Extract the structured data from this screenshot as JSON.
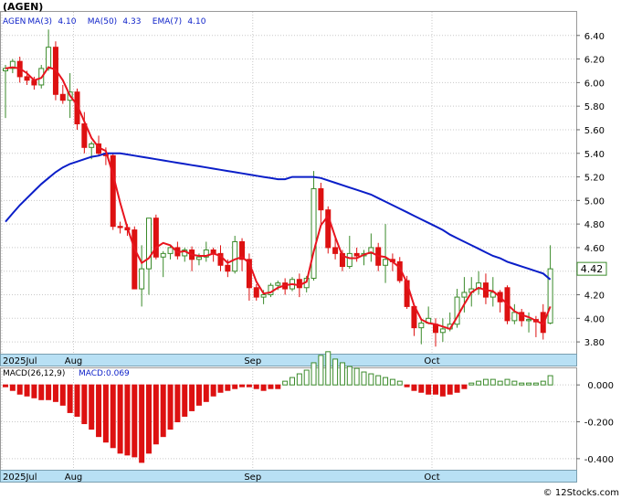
{
  "chart_data": {
    "ticker_label": "(AGEN)",
    "price_panel": {
      "type": "candlestick",
      "legend": [
        {
          "label": "AGEN",
          "value": "",
          "color": "#000000"
        },
        {
          "label": "MA(3)",
          "value": "4.10",
          "color": "#e8141e"
        },
        {
          "label": "MA(50)",
          "value": "4.33",
          "color": "#0a1ec8"
        },
        {
          "label": "EMA(7)",
          "value": "4.10",
          "color": "#000000"
        }
      ],
      "last_price_label": "4.42",
      "ylim": [
        3.7,
        6.6
      ],
      "y_ticks": [
        "6.40",
        "6.20",
        "6.00",
        "5.80",
        "5.60",
        "5.40",
        "5.20",
        "5.00",
        "4.80",
        "4.60",
        "4.40",
        "4.20",
        "4.00",
        "3.80"
      ],
      "y_tick_values": [
        6.4,
        6.2,
        6.0,
        5.8,
        5.6,
        5.4,
        5.2,
        5.0,
        4.8,
        4.6,
        4.4,
        4.2,
        4.0,
        3.8
      ],
      "x_labels": [
        {
          "label": "2025Jul",
          "index": 0
        },
        {
          "label": "Aug",
          "index": 10
        },
        {
          "label": "Sep",
          "index": 35
        },
        {
          "label": "Oct",
          "index": 60
        }
      ],
      "candles": [
        [
          6.1,
          6.15,
          5.7,
          6.12
        ],
        [
          6.12,
          6.2,
          6.08,
          6.18
        ],
        [
          6.18,
          6.22,
          6.0,
          6.05
        ],
        [
          6.05,
          6.1,
          5.98,
          6.02
        ],
        [
          6.02,
          6.05,
          5.94,
          5.98
        ],
        [
          5.98,
          6.15,
          5.95,
          6.12
        ],
        [
          6.12,
          6.45,
          6.1,
          6.3
        ],
        [
          6.3,
          6.35,
          5.85,
          5.9
        ],
        [
          5.9,
          5.98,
          5.82,
          5.85
        ],
        [
          5.85,
          6.08,
          5.7,
          5.92
        ],
        [
          5.92,
          5.95,
          5.6,
          5.65
        ],
        [
          5.65,
          5.75,
          5.4,
          5.45
        ],
        [
          5.45,
          5.5,
          5.35,
          5.48
        ],
        [
          5.48,
          5.55,
          5.38,
          5.4
        ],
        [
          5.4,
          5.45,
          5.3,
          5.38
        ],
        [
          5.38,
          5.4,
          4.75,
          4.78
        ],
        [
          4.78,
          4.82,
          4.72,
          4.77
        ],
        [
          4.77,
          4.8,
          4.7,
          4.75
        ],
        [
          4.75,
          4.78,
          4.25,
          4.25
        ],
        [
          4.25,
          4.62,
          4.1,
          4.42
        ],
        [
          4.42,
          4.8,
          4.2,
          4.85
        ],
        [
          4.85,
          4.88,
          4.5,
          4.52
        ],
        [
          4.52,
          4.57,
          4.35,
          4.55
        ],
        [
          4.55,
          4.62,
          4.5,
          4.6
        ],
        [
          4.6,
          4.65,
          4.5,
          4.53
        ],
        [
          4.53,
          4.6,
          4.48,
          4.58
        ],
        [
          4.58,
          4.61,
          4.4,
          4.5
        ],
        [
          4.5,
          4.55,
          4.45,
          4.52
        ],
        [
          4.52,
          4.65,
          4.48,
          4.58
        ],
        [
          4.58,
          4.6,
          4.48,
          4.55
        ],
        [
          4.55,
          4.62,
          4.4,
          4.45
        ],
        [
          4.45,
          4.5,
          4.35,
          4.4
        ],
        [
          4.4,
          4.7,
          4.38,
          4.65
        ],
        [
          4.65,
          4.68,
          4.4,
          4.5
        ],
        [
          4.5,
          4.55,
          4.15,
          4.26
        ],
        [
          4.26,
          4.29,
          4.15,
          4.18
        ],
        [
          4.18,
          4.24,
          4.12,
          4.2
        ],
        [
          4.2,
          4.3,
          4.18,
          4.28
        ],
        [
          4.28,
          4.32,
          4.24,
          4.3
        ],
        [
          4.3,
          4.34,
          4.2,
          4.25
        ],
        [
          4.25,
          4.35,
          4.23,
          4.33
        ],
        [
          4.33,
          4.38,
          4.18,
          4.26
        ],
        [
          4.26,
          4.36,
          4.22,
          4.34
        ],
        [
          4.34,
          5.25,
          4.32,
          5.1
        ],
        [
          5.1,
          5.15,
          4.8,
          4.92
        ],
        [
          4.92,
          4.95,
          4.55,
          4.6
        ],
        [
          4.6,
          4.7,
          4.5,
          4.55
        ],
        [
          4.55,
          4.58,
          4.4,
          4.44
        ],
        [
          4.44,
          4.7,
          4.42,
          4.55
        ],
        [
          4.55,
          4.6,
          4.48,
          4.53
        ],
        [
          4.53,
          4.58,
          4.45,
          4.55
        ],
        [
          4.55,
          4.72,
          4.48,
          4.6
        ],
        [
          4.6,
          4.64,
          4.4,
          4.45
        ],
        [
          4.45,
          4.8,
          4.3,
          4.5
        ],
        [
          4.5,
          4.55,
          4.4,
          4.48
        ],
        [
          4.48,
          4.52,
          4.3,
          4.32
        ],
        [
          4.32,
          4.36,
          4.08,
          4.1
        ],
        [
          4.1,
          4.12,
          3.85,
          3.92
        ],
        [
          3.92,
          4.0,
          3.78,
          3.96
        ],
        [
          3.96,
          4.1,
          3.95,
          4.0
        ],
        [
          3.95,
          4.0,
          3.76,
          3.88
        ],
        [
          3.88,
          4.0,
          3.8,
          3.91
        ],
        [
          3.91,
          4.05,
          3.89,
          3.95
        ],
        [
          3.95,
          4.25,
          3.92,
          4.18
        ],
        [
          4.18,
          4.35,
          4.05,
          4.22
        ],
        [
          4.22,
          4.35,
          4.1,
          4.25
        ],
        [
          4.25,
          4.4,
          4.2,
          4.3
        ],
        [
          4.3,
          4.38,
          4.12,
          4.18
        ],
        [
          4.18,
          4.35,
          4.1,
          4.22
        ],
        [
          4.22,
          4.24,
          4.05,
          4.14
        ],
        [
          4.26,
          4.28,
          3.95,
          3.98
        ],
        [
          3.98,
          4.12,
          3.95,
          4.05
        ],
        [
          4.05,
          4.08,
          3.93,
          3.98
        ],
        [
          3.98,
          4.05,
          3.88,
          3.99
        ],
        [
          3.99,
          4.02,
          3.84,
          3.97
        ],
        [
          4.05,
          4.12,
          3.82,
          3.88
        ],
        [
          3.96,
          4.62,
          3.95,
          4.42
        ]
      ],
      "ma3": [
        6.12,
        6.13,
        6.12,
        6.08,
        6.02,
        6.04,
        6.13,
        6.11,
        6.02,
        5.89,
        5.81,
        5.67,
        5.53,
        5.45,
        5.42,
        5.22,
        4.98,
        4.77,
        4.59,
        4.47,
        4.51,
        4.6,
        4.64,
        4.62,
        4.56,
        4.57,
        4.54,
        4.53,
        4.53,
        4.55,
        4.53,
        4.47,
        4.5,
        4.52,
        4.47,
        4.31,
        4.21,
        4.22,
        4.26,
        4.28,
        4.29,
        4.28,
        4.31,
        4.57,
        4.79,
        4.87,
        4.69,
        4.53,
        4.51,
        4.51,
        4.54,
        4.56,
        4.53,
        4.52,
        4.48,
        4.43,
        4.3,
        4.11,
        3.99,
        3.96,
        3.95,
        3.93,
        3.91,
        4.01,
        4.12,
        4.22,
        4.26,
        4.24,
        4.23,
        4.18,
        4.12,
        4.06,
        4.03,
        4.01,
        3.98,
        3.95,
        4.1
      ],
      "ma50": [
        4.82,
        4.89,
        4.96,
        5.02,
        5.08,
        5.14,
        5.19,
        5.24,
        5.28,
        5.31,
        5.33,
        5.35,
        5.37,
        5.38,
        5.4,
        5.4,
        5.4,
        5.39,
        5.38,
        5.37,
        5.36,
        5.35,
        5.34,
        5.33,
        5.32,
        5.31,
        5.3,
        5.29,
        5.28,
        5.27,
        5.26,
        5.25,
        5.24,
        5.23,
        5.22,
        5.21,
        5.2,
        5.19,
        5.18,
        5.18,
        5.2,
        5.2,
        5.2,
        5.2,
        5.19,
        5.17,
        5.15,
        5.13,
        5.11,
        5.09,
        5.07,
        5.05,
        5.02,
        4.99,
        4.96,
        4.93,
        4.9,
        4.87,
        4.84,
        4.81,
        4.78,
        4.75,
        4.71,
        4.68,
        4.65,
        4.62,
        4.59,
        4.56,
        4.53,
        4.51,
        4.48,
        4.46,
        4.44,
        4.42,
        4.4,
        4.38,
        4.33
      ]
    },
    "macd_panel": {
      "label": "MACD(26,12,9)",
      "value_label": "MACD:0.069",
      "ylim": [
        -0.46,
        0.09
      ],
      "y_ticks": [
        "0.000",
        "-0.200",
        "-0.400"
      ],
      "y_tick_values": [
        0,
        -0.2,
        -0.4
      ],
      "x_labels": [
        {
          "label": "2025Jul",
          "index": 0
        },
        {
          "label": "Aug",
          "index": 10
        },
        {
          "label": "Sep",
          "index": 35
        },
        {
          "label": "Oct",
          "index": 60
        }
      ],
      "histogram": [
        -0.01,
        -0.03,
        -0.05,
        -0.06,
        -0.07,
        -0.08,
        -0.08,
        -0.09,
        -0.11,
        -0.15,
        -0.17,
        -0.21,
        -0.24,
        -0.28,
        -0.31,
        -0.34,
        -0.37,
        -0.38,
        -0.39,
        -0.42,
        -0.37,
        -0.32,
        -0.28,
        -0.24,
        -0.2,
        -0.17,
        -0.14,
        -0.11,
        -0.09,
        -0.06,
        -0.04,
        -0.03,
        -0.02,
        -0.01,
        -0.01,
        -0.02,
        -0.03,
        -0.02,
        -0.02,
        0.02,
        0.04,
        0.06,
        0.08,
        0.12,
        0.16,
        0.18,
        0.14,
        0.12,
        0.1,
        0.09,
        0.07,
        0.06,
        0.05,
        0.04,
        0.03,
        0.02,
        -0.01,
        -0.03,
        -0.04,
        -0.05,
        -0.05,
        -0.06,
        -0.05,
        -0.04,
        -0.02,
        0.01,
        0.02,
        0.03,
        0.03,
        0.02,
        0.03,
        0.02,
        0.01,
        0.01,
        0.01,
        0.02,
        0.05
      ]
    },
    "colors": {
      "up": "#3a8a2a",
      "down": "#dd1111",
      "ma_fast": "#e8141e",
      "ma_slow": "#0a1ec8",
      "axis_band": "#b8e0f4",
      "grid": "#c8c8c8"
    }
  },
  "watermark": "© 12Stocks.com"
}
